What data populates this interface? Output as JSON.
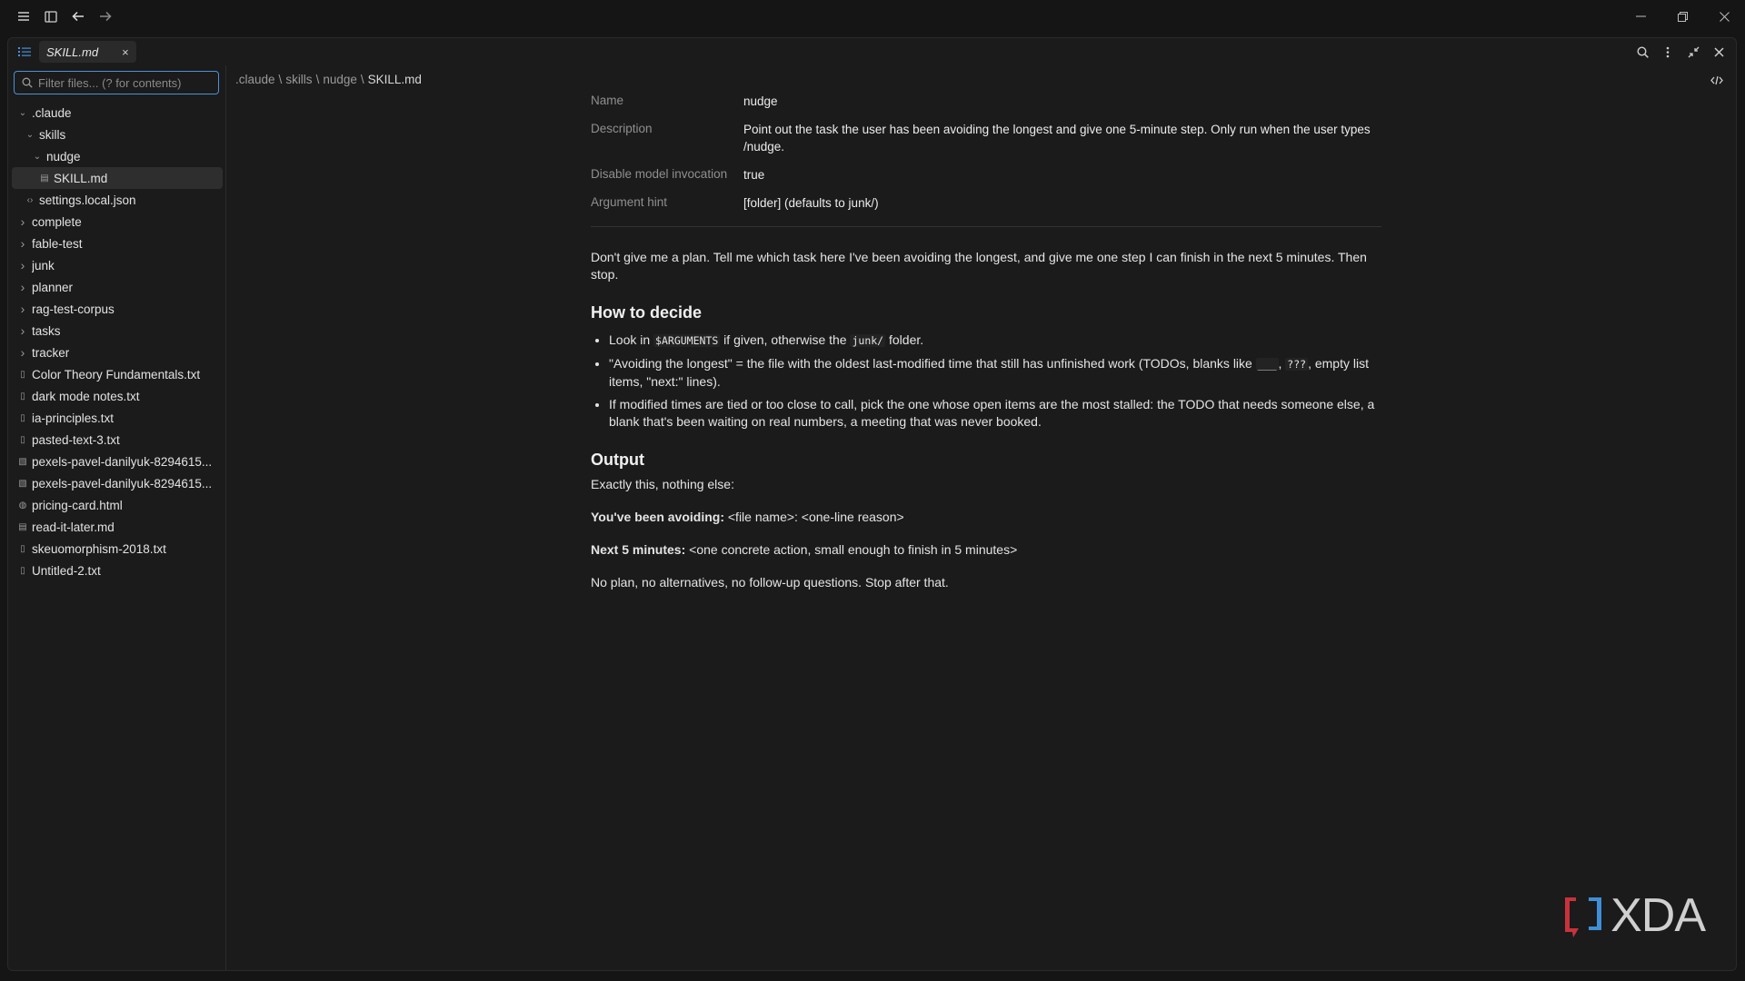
{
  "tab": {
    "label": "SKILL.md",
    "close": "×"
  },
  "filter": {
    "placeholder": "Filter files... (? for contents)"
  },
  "breadcrumb": {
    "parts": [
      ".claude",
      "skills",
      "nudge"
    ],
    "sep": "\\",
    "current": "SKILL.md"
  },
  "tree": [
    {
      "label": ".claude",
      "icon": "chevron-down",
      "depth": 0
    },
    {
      "label": "skills",
      "icon": "chevron-down",
      "depth": 1
    },
    {
      "label": "nudge",
      "icon": "chevron-down",
      "depth": 2
    },
    {
      "label": "SKILL.md",
      "icon": "markdown-file",
      "depth": 3,
      "selected": true
    },
    {
      "label": "settings.local.json",
      "icon": "code-file",
      "depth": 1
    },
    {
      "label": "complete",
      "icon": "chevron-right",
      "depth": 0
    },
    {
      "label": "fable-test",
      "icon": "chevron-right",
      "depth": 0
    },
    {
      "label": "junk",
      "icon": "chevron-right",
      "depth": 0
    },
    {
      "label": "planner",
      "icon": "chevron-right",
      "depth": 0
    },
    {
      "label": "rag-test-corpus",
      "icon": "chevron-right",
      "depth": 0
    },
    {
      "label": "tasks",
      "icon": "chevron-right",
      "depth": 0
    },
    {
      "label": "tracker",
      "icon": "chevron-right",
      "depth": 0
    },
    {
      "label": "Color Theory Fundamentals.txt",
      "icon": "file",
      "depth": 0
    },
    {
      "label": "dark mode notes.txt",
      "icon": "file",
      "depth": 0
    },
    {
      "label": "ia-principles.txt",
      "icon": "file",
      "depth": 0
    },
    {
      "label": "pasted-text-3.txt",
      "icon": "file",
      "depth": 0
    },
    {
      "label": "pexels-pavel-danilyuk-8294615...",
      "icon": "image-file",
      "depth": 0
    },
    {
      "label": "pexels-pavel-danilyuk-8294615...",
      "icon": "image-file",
      "depth": 0
    },
    {
      "label": "pricing-card.html",
      "icon": "globe-file",
      "depth": 0
    },
    {
      "label": "read-it-later.md",
      "icon": "markdown-file",
      "depth": 0
    },
    {
      "label": "skeuomorphism-2018.txt",
      "icon": "file",
      "depth": 0
    },
    {
      "label": "Untitled-2.txt",
      "icon": "file",
      "depth": 0
    }
  ],
  "frontmatter": [
    {
      "key": "Name",
      "value": "nudge"
    },
    {
      "key": "Description",
      "value": "Point out the task the user has been avoiding the longest and give one 5-minute step. Only run when the user types /nudge."
    },
    {
      "key": "Disable model invocation",
      "value": "true"
    },
    {
      "key": "Argument hint",
      "value": "[folder] (defaults to junk/)"
    }
  ],
  "doc": {
    "intro": "Don't give me a plan. Tell me which task here I've been avoiding the longest, and give me one step I can finish in the next 5 minutes. Then stop.",
    "h_decide": "How to decide",
    "b1": {
      "a": "Look in ",
      "code1": "$ARGUMENTS",
      "b": " if given, otherwise the ",
      "code2": "junk/",
      "c": " folder."
    },
    "b2": {
      "a": "\"Avoiding the longest\" = the file with the oldest last-modified time that still has unfinished work (TODOs, blanks like ",
      "code1": "___",
      "b": ", ",
      "code2": "???",
      "c": ", empty list items, \"next:\" lines)."
    },
    "b3": "If modified times are tied or too close to call, pick the one whose open items are the most stalled: the TODO that needs someone else, a blank that's been waiting on real numbers, a meeting that was never booked.",
    "h_output": "Output",
    "exactly": "Exactly this, nothing else:",
    "avoid_label": "You've been avoiding:",
    "avoid_value": " <file name>: <one-line reason>",
    "next_label": "Next 5 minutes:",
    "next_value": " <one concrete action, small enough to finish in 5 minutes>",
    "closing": "No plan, no alternatives, no follow-up questions. Stop after that."
  },
  "watermark": {
    "text": "XDA"
  },
  "colors": {
    "accent": "#4a90d9",
    "bg": "#1b1b1b",
    "logo_red": "#c8323c",
    "logo_blue": "#3f8fd6"
  }
}
